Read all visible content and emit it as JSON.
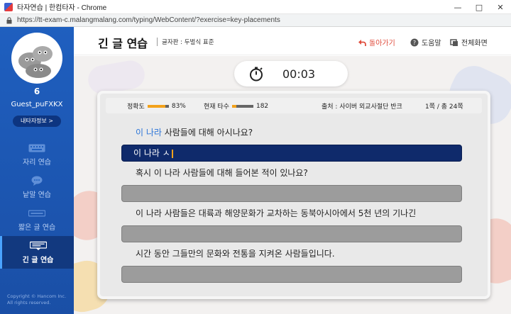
{
  "window": {
    "title": "타자연습 | 한컴타자 - Chrome",
    "url": "https://tt-exam-c.malangmalang.com/typing/WebContent/?exercise=key-placements"
  },
  "sidebar": {
    "level": "6",
    "username": "Guest_puFXKX",
    "profile_button": "내타자정보 >",
    "items": [
      {
        "label": "자리 연습",
        "icon": "keyboard-icon"
      },
      {
        "label": "낱말 연습",
        "icon": "speech-bubble-icon"
      },
      {
        "label": "짧은 글 연습",
        "icon": "short-text-icon"
      },
      {
        "label": "긴 글 연습",
        "icon": "long-text-icon"
      }
    ],
    "copyright": [
      "Copyright © Hancom Inc.",
      "All rights reserved."
    ]
  },
  "header": {
    "title": "긴 글 연습",
    "layout_label": "글자판 : 두벌식 표준",
    "back_label": "돌아가기",
    "help_label": "도움말",
    "fullscreen_label": "전체화면"
  },
  "timer": {
    "value": "00:03"
  },
  "stats": {
    "accuracy_label": "정확도",
    "accuracy_value": "83%",
    "accuracy_fraction": 0.83,
    "speed_label": "현재 타수",
    "speed_value": "182",
    "speed_fraction": 0.2,
    "source": "출처 : 사이버 외교사절단 반크",
    "page": "1쪽 / 총 24쪽"
  },
  "lines": [
    {
      "typed": "이 나라",
      "rest": " 사람들에 대해 아시나요?",
      "input": "이 나라 ㅅ"
    },
    {
      "typed": "",
      "rest": "혹시 이 나라 사람들에 대해 들어본 적이 있나요?",
      "input": ""
    },
    {
      "typed": "",
      "rest": "이 나라 사람들은 대륙과 해양문화가 교차하는 동북아시아에서 5천 년의 기나긴",
      "input": ""
    },
    {
      "typed": "",
      "rest": "시간 동안 그들만의 문화와 전통을 지켜온 사람들입니다.",
      "input": ""
    }
  ],
  "colors": {
    "sidebar": "#1f5fbf",
    "active_input": "#0f2a6b",
    "accent": "#f3a21b",
    "back": "#e04c3c"
  }
}
